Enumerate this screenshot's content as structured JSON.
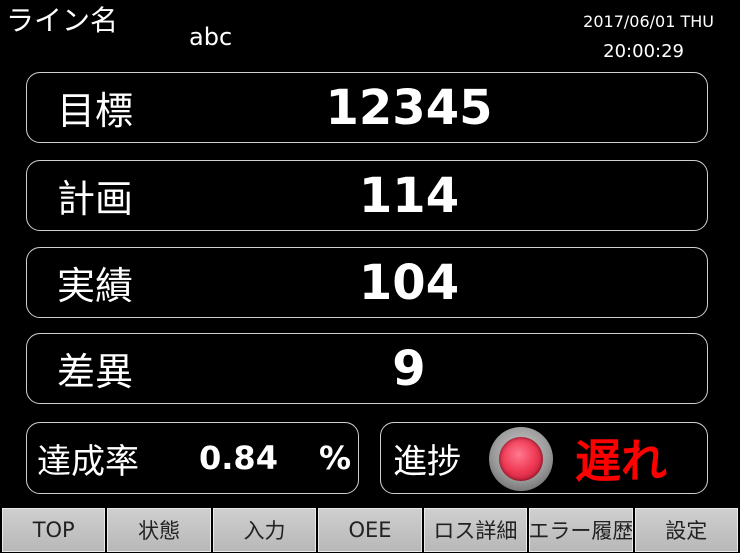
{
  "header": {
    "line_label": "ライン名",
    "line_value": "abc",
    "date": "2017/06/01 THU",
    "time": "20:00:29"
  },
  "metrics": [
    {
      "label": "目標",
      "value": "12345"
    },
    {
      "label": "計画",
      "value": "114"
    },
    {
      "label": "実績",
      "value": "104"
    },
    {
      "label": "差異",
      "value": "9"
    }
  ],
  "achievement": {
    "label": "達成率",
    "value": "0.84",
    "unit": "%"
  },
  "progress": {
    "label": "進捗",
    "status": "遅れ",
    "lamp_color": "#f03d58",
    "status_color": "#ff0000"
  },
  "menu": [
    "TOP",
    "状態",
    "入力",
    "OEE",
    "ロス詳細",
    "エラー履歴",
    "設定"
  ]
}
